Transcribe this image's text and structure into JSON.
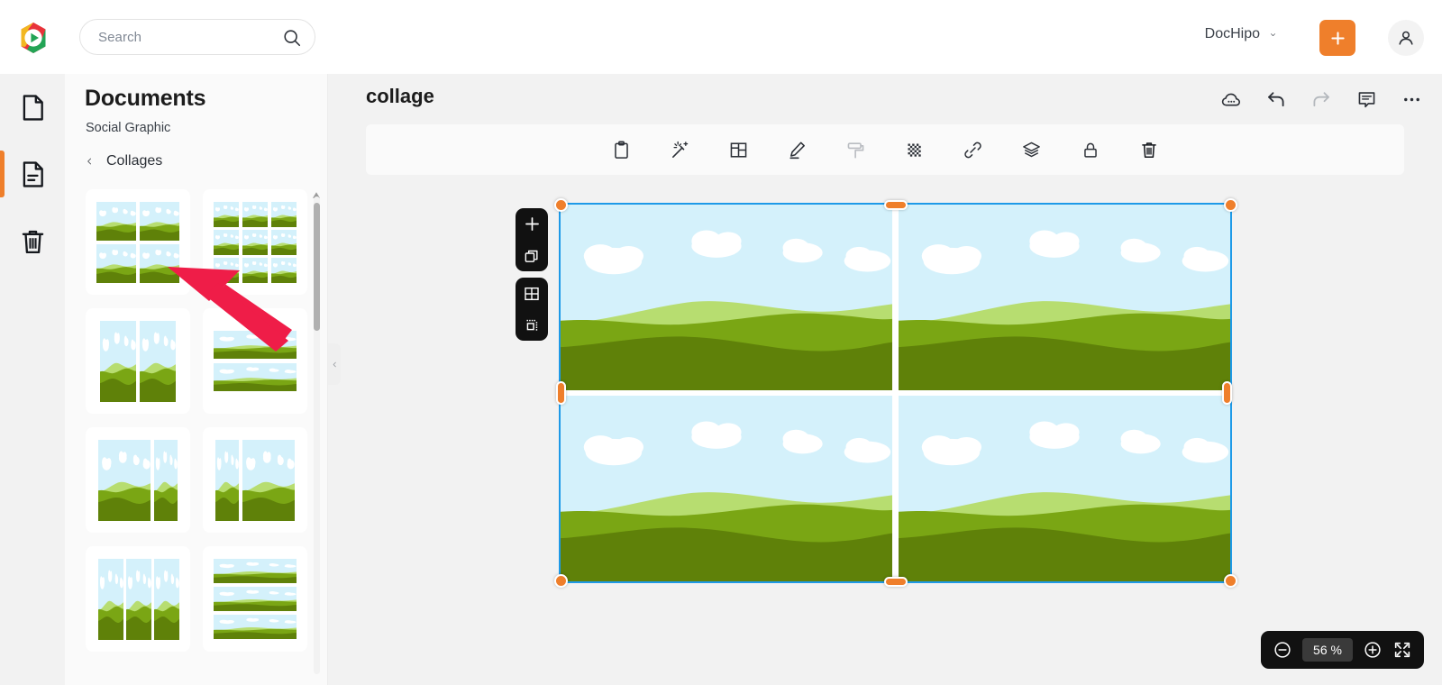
{
  "header": {
    "logo_icon": "dochipo-logo-icon",
    "search": {
      "placeholder": "Search",
      "value": "",
      "icon": "search-icon"
    },
    "workspace": {
      "label": "DocHipo",
      "icon": "chevron-down-icon"
    },
    "create_button": {
      "label": "+",
      "icon": "plus-icon",
      "color": "#ef7f2b"
    },
    "account_button": {
      "icon": "user-avatar-icon"
    }
  },
  "rail": {
    "items": [
      {
        "name": "blank-page",
        "icon": "page-icon",
        "active": false
      },
      {
        "name": "documents",
        "icon": "document-lines-icon",
        "active": true
      },
      {
        "name": "trash",
        "icon": "trash-icon",
        "active": false
      }
    ],
    "active_indicator_color": "#ef7f2b"
  },
  "sidebar": {
    "title": "Documents",
    "subtitle": "Social Graphic",
    "breadcrumb": {
      "back_icon": "chevron-left-icon",
      "label": "Collages"
    },
    "scrollbar": {
      "icon": "scroll-up-arrow-icon"
    },
    "collapse_handle": {
      "icon": "chevron-left-icon"
    },
    "templates": [
      {
        "name": "collage-2x2",
        "layout": "grid-2x2"
      },
      {
        "name": "collage-3x3",
        "layout": "grid-3x3"
      },
      {
        "name": "collage-1x2-vertical",
        "layout": "cols-2-equal"
      },
      {
        "name": "collage-2x1-horizontal",
        "layout": "rows-2-equal"
      },
      {
        "name": "collage-2col-wide-left",
        "layout": "cols-2-wide-left"
      },
      {
        "name": "collage-2col-wide-right",
        "layout": "cols-2-wide-right"
      },
      {
        "name": "collage-3col",
        "layout": "cols-3"
      },
      {
        "name": "collage-3row",
        "layout": "rows-3"
      }
    ]
  },
  "editor": {
    "document_title": "collage",
    "actions": [
      {
        "name": "cloud-save-icon",
        "label": "cloud-save",
        "state": "saved"
      },
      {
        "name": "undo-icon",
        "label": "undo",
        "state": "enabled"
      },
      {
        "name": "redo-icon",
        "label": "redo",
        "state": "disabled"
      },
      {
        "name": "comment-icon",
        "label": "comment",
        "state": "enabled"
      },
      {
        "name": "more-options-icon",
        "label": "more",
        "state": "enabled"
      }
    ],
    "property_bar": [
      {
        "name": "clipboard-icon",
        "label": "Paste / Clipboard"
      },
      {
        "name": "magic-wand-icon",
        "label": "Effects"
      },
      {
        "name": "grid-layout-icon",
        "label": "Collage layout"
      },
      {
        "name": "pencil-edit-icon",
        "label": "Edit"
      },
      {
        "name": "paint-roller-icon",
        "label": "Style painter"
      },
      {
        "name": "transparency-icon",
        "label": "Transparency"
      },
      {
        "name": "link-icon",
        "label": "Link"
      },
      {
        "name": "layers-icon",
        "label": "Position / Layers"
      },
      {
        "name": "lock-icon",
        "label": "Lock"
      },
      {
        "name": "delete-icon",
        "label": "Delete"
      }
    ],
    "float_panels": [
      {
        "name": "add-panel",
        "buttons": [
          {
            "name": "add-icon",
            "label": "Add"
          },
          {
            "name": "duplicate-icon",
            "label": "Duplicate"
          }
        ]
      },
      {
        "name": "collage-panel",
        "buttons": [
          {
            "name": "grid-layout-icon",
            "label": "Change layout"
          },
          {
            "name": "crop-icon",
            "label": "Crop"
          }
        ]
      }
    ],
    "selection": {
      "border_color": "#1e9ae8",
      "handle_color": "#ef7f2b",
      "handles": [
        "top-left",
        "top-center",
        "top-right",
        "middle-left",
        "middle-right",
        "bottom-left",
        "bottom-center",
        "bottom-right"
      ]
    },
    "canvas_object": {
      "type": "collage",
      "layout": "grid-2x2",
      "cells": 4,
      "image": "green-hills-landscape-with-clouds"
    },
    "zoom": {
      "value": "56 %",
      "minus_icon": "zoom-out-icon",
      "plus_icon": "zoom-in-icon",
      "fit_icon": "fullscreen-icon"
    }
  },
  "annotation": {
    "arrow": {
      "name": "red-pointer-arrow",
      "color": "#ef1d48",
      "points_to": "collage-2x2-template"
    }
  },
  "palette": {
    "sky": "#d4f1fb",
    "hill_light": "#b7dd70",
    "hill_mid": "#7aa614",
    "hill_dark": "#5f8109",
    "accent": "#ef7f2b",
    "selection_blue": "#1e9ae8",
    "arrow_red": "#ef1d48"
  }
}
